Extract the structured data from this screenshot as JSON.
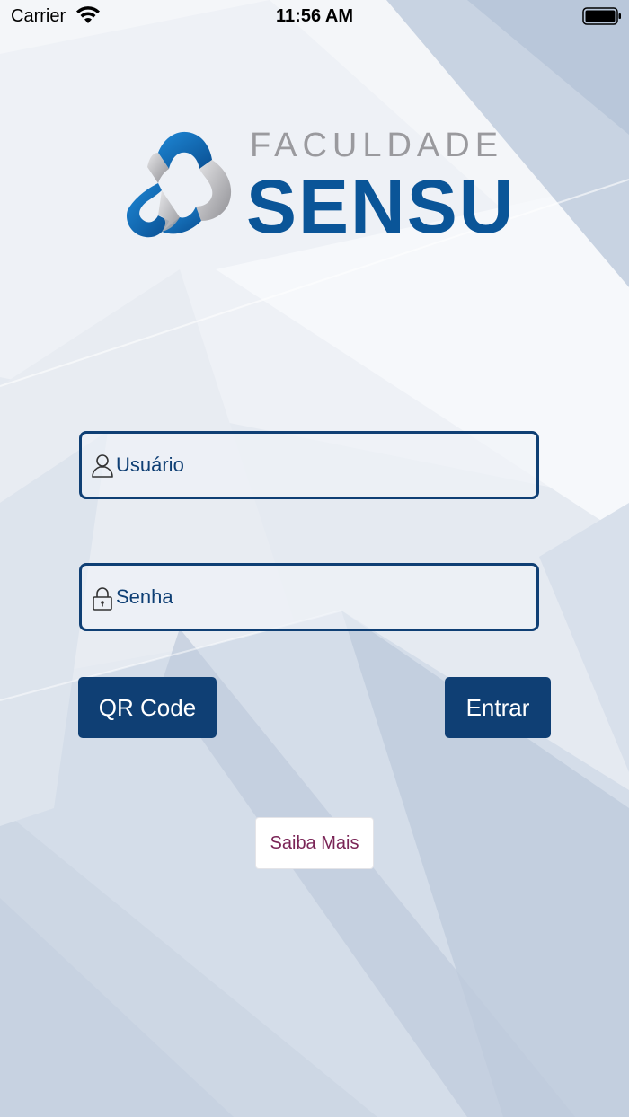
{
  "status_bar": {
    "carrier": "Carrier",
    "time": "11:56 AM"
  },
  "logo": {
    "top_text": "FACULDADE",
    "main_text": "SENSU",
    "brand_blue": "#0a5598",
    "gray": "#9a9a9e"
  },
  "login": {
    "username_placeholder": "Usuário",
    "password_placeholder": "Senha",
    "user_icon": "user-icon",
    "lock_icon": "lock-icon"
  },
  "buttons": {
    "qr_code": "QR Code",
    "enter": "Entrar",
    "learn_more": "Saiba Mais"
  },
  "colors": {
    "primary": "#0f3f74",
    "secondary_text": "#7a2456"
  }
}
